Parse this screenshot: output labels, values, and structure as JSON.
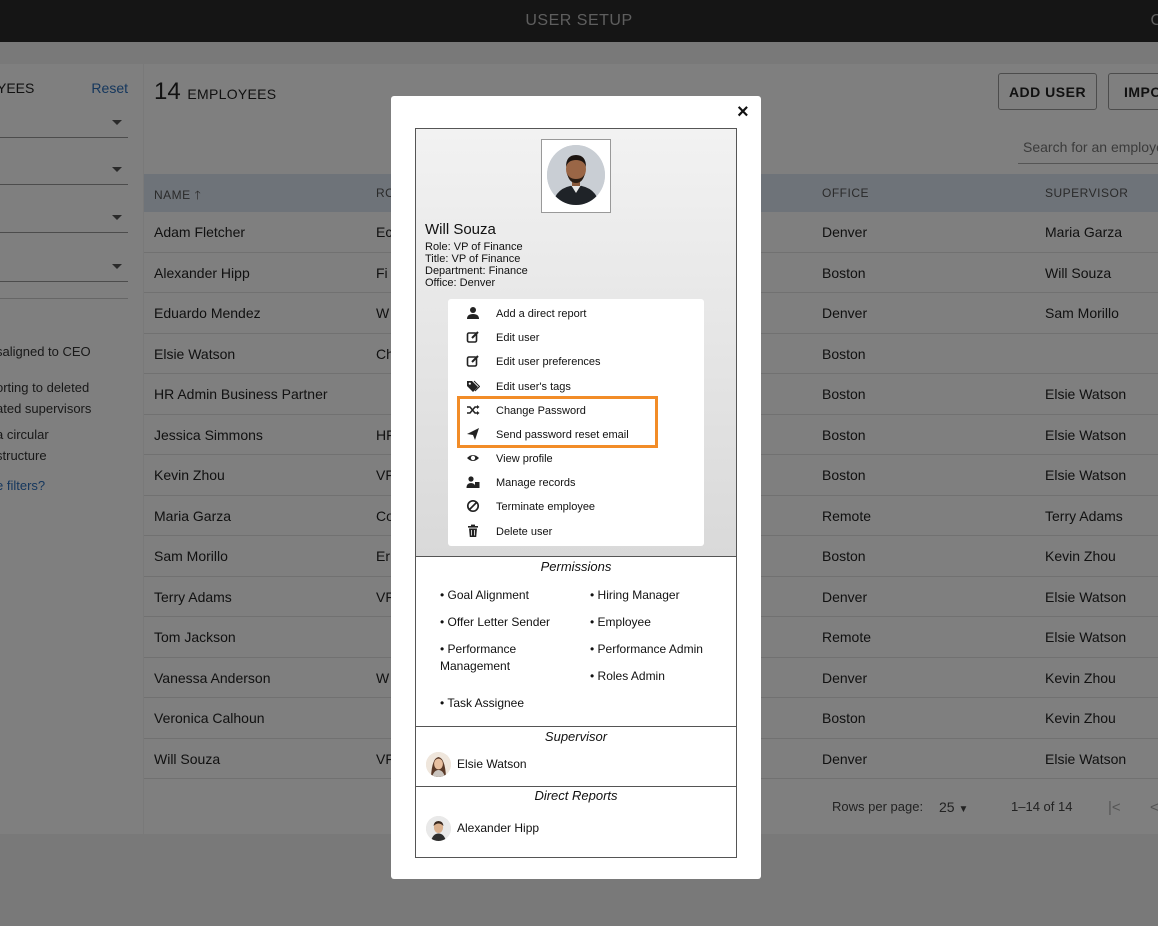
{
  "app": {
    "title": "USER SETUP",
    "corner_letter": "C"
  },
  "filters": {
    "heading": "YEES",
    "reset_label": "Reset",
    "notes": [
      "saligned to CEO",
      "orting to deleted",
      "ated supervisors",
      "a circular",
      "structure"
    ],
    "more_link": "e filters?"
  },
  "main": {
    "count": "14",
    "count_label": "EMPLOYEES",
    "add_user_label": "ADD USER",
    "import_label": "IMPO",
    "search_placeholder": "Search for an employee",
    "columns": {
      "name": "NAME",
      "role": "RO",
      "office": "OFFICE",
      "supervisor": "SUPERVISOR"
    },
    "rows": [
      {
        "name": "Adam Fletcher",
        "role": "Ec",
        "office": "Denver",
        "supervisor": "Maria Garza"
      },
      {
        "name": "Alexander Hipp",
        "role": "Fi",
        "office": "Boston",
        "supervisor": "Will Souza"
      },
      {
        "name": "Eduardo Mendez",
        "role": "W",
        "office": "Denver",
        "supervisor": "Sam Morillo"
      },
      {
        "name": "Elsie Watson",
        "role": "Ch",
        "office": "Boston",
        "supervisor": ""
      },
      {
        "name": "HR Admin Business Partner",
        "role": "",
        "office": "Boston",
        "supervisor": "Elsie Watson"
      },
      {
        "name": "Jessica Simmons",
        "role": "HF",
        "office": "Boston",
        "supervisor": "Elsie Watson"
      },
      {
        "name": "Kevin Zhou",
        "role": "VF",
        "office": "Boston",
        "supervisor": "Elsie Watson"
      },
      {
        "name": "Maria Garza",
        "role": "Co",
        "office": "Remote",
        "supervisor": "Terry Adams"
      },
      {
        "name": "Sam Morillo",
        "role": "Er",
        "office": "Boston",
        "supervisor": "Kevin Zhou"
      },
      {
        "name": "Terry Adams",
        "role": "VF",
        "office": "Denver",
        "supervisor": "Elsie Watson"
      },
      {
        "name": "Tom Jackson",
        "role": "",
        "office": "Remote",
        "supervisor": "Elsie Watson"
      },
      {
        "name": "Vanessa Anderson",
        "role": "W",
        "office": "Denver",
        "supervisor": "Kevin Zhou"
      },
      {
        "name": "Veronica Calhoun",
        "role": "",
        "office": "Boston",
        "supervisor": "Kevin Zhou"
      },
      {
        "name": "Will Souza",
        "role": "VF",
        "office": "Denver",
        "supervisor": "Elsie Watson"
      }
    ],
    "rows_per_page_label": "Rows per page:",
    "rows_per_page_value": "25",
    "range_label": "1–14 of 14"
  },
  "modal": {
    "close_symbol": "×",
    "profile": {
      "name": "Will Souza",
      "role": "Role: VP of Finance",
      "title": "Title: VP of Finance",
      "department": "Department: Finance",
      "office": "Office: Denver"
    },
    "menu": [
      {
        "label": "Add a direct report",
        "icon": "person-icon"
      },
      {
        "label": "Edit user",
        "icon": "edit-icon"
      },
      {
        "label": "Edit user preferences",
        "icon": "edit-icon"
      },
      {
        "label": "Edit user's tags",
        "icon": "tags-icon"
      },
      {
        "label": "Change Password",
        "icon": "shuffle-icon"
      },
      {
        "label": "Send password reset email",
        "icon": "send-icon"
      },
      {
        "label": "View profile",
        "icon": "eye-icon"
      },
      {
        "label": "Manage records",
        "icon": "user-records-icon"
      },
      {
        "label": "Terminate employee",
        "icon": "ban-icon"
      },
      {
        "label": "Delete user",
        "icon": "trash-icon"
      }
    ],
    "highlight_color": "#f28c28",
    "permissions_title": "Permissions",
    "permissions": [
      "• Goal Alignment",
      "• Hiring Manager",
      "• Offer Letter Sender",
      "• Employee",
      "• Performance Management",
      "• Performance Admin",
      "• Roles Admin",
      "• Task Assignee"
    ],
    "supervisor_title": "Supervisor",
    "supervisor_name": "Elsie Watson",
    "direct_reports_title": "Direct Reports",
    "direct_report_name": "Alexander Hipp"
  }
}
